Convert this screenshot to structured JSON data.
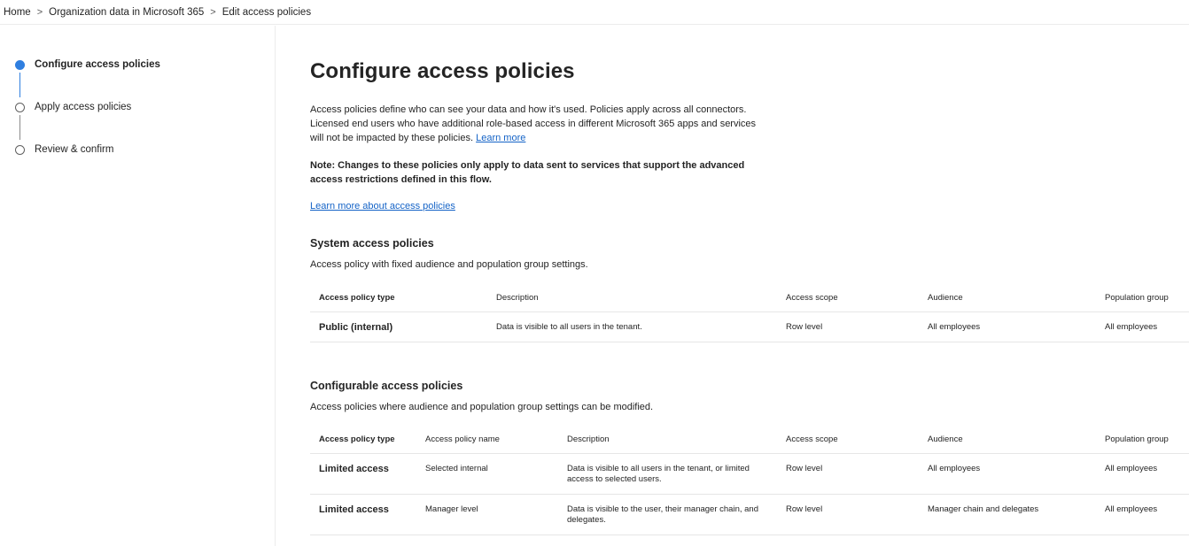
{
  "breadcrumb": {
    "items": [
      "Home",
      "Organization data in Microsoft 365",
      "Edit access policies"
    ],
    "separator": ">"
  },
  "steps": [
    {
      "label": "Configure access policies",
      "active": true
    },
    {
      "label": "Apply access policies",
      "active": false
    },
    {
      "label": "Review & confirm",
      "active": false
    }
  ],
  "page": {
    "title": "Configure access policies",
    "intro": "Access policies define who can see your data and how it's used. Policies apply across all connectors. Licensed end users who have additional role-based access in different Microsoft 365 apps and services will not be impacted by these policies.",
    "intro_link": "Learn more",
    "note": "Note: Changes to these policies only apply to data sent to services that support the advanced access restrictions defined in this flow.",
    "learn_more_link": "Learn more about access policies"
  },
  "system_policies": {
    "title": "System access policies",
    "description": "Access policy with fixed audience and population group settings.",
    "columns": [
      "Access policy type",
      "Description",
      "Access scope",
      "Audience",
      "Population group"
    ],
    "rows": [
      {
        "type": "Public (internal)",
        "description": "Data is visible to all users in the tenant.",
        "scope": "Row level",
        "audience": "All employees",
        "population": "All employees"
      }
    ]
  },
  "configurable_policies": {
    "title": "Configurable access policies",
    "description": "Access policies where audience and population group settings can be modified.",
    "columns": [
      "Access policy type",
      "Access policy name",
      "Description",
      "Access scope",
      "Audience",
      "Population group"
    ],
    "rows": [
      {
        "type": "Limited access",
        "name": "Selected internal",
        "description": "Data is visible to all users in the tenant, or limited access to selected users.",
        "scope": "Row level",
        "audience": "All employees",
        "population": "All employees"
      },
      {
        "type": "Limited access",
        "name": "Manager level",
        "description": "Data is visible to the user, their manager chain, and delegates.",
        "scope": "Row level",
        "audience": "Manager chain and delegates",
        "population": "All employees"
      }
    ]
  },
  "colors": {
    "accent": "#2f7fe0",
    "link": "#1463c7",
    "text": "#242424",
    "divider": "#e6e6e6"
  }
}
